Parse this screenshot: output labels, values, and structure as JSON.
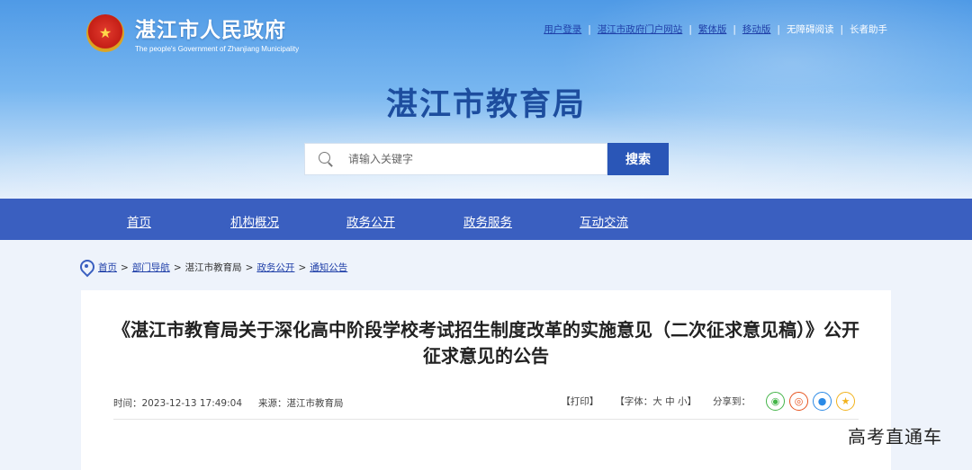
{
  "header": {
    "logo_cn": "湛江市人民政府",
    "logo_en": "The people's Government of Zhanjiang Municipality",
    "site_title": "湛江市教育局",
    "toplinks": [
      "用户登录",
      "湛江市政府门户网站",
      "繁体版",
      "移动版",
      "无障碍阅读",
      "长者助手"
    ]
  },
  "search": {
    "placeholder": "请输入关键字",
    "button": "搜索"
  },
  "nav": [
    "首页",
    "机构概况",
    "政务公开",
    "政务服务",
    "互动交流"
  ],
  "breadcrumb": [
    "首页",
    "部门导航",
    "湛江市教育局",
    "政务公开",
    "通知公告"
  ],
  "article": {
    "title": "《湛江市教育局关于深化高中阶段学校考试招生制度改革的实施意见（二次征求意见稿）》公开征求意见的公告",
    "time": "时间：2023-12-13 17:49:04",
    "source": "来源：湛江市教育局",
    "print": "【打印】",
    "font_size": "【字体：大 中 小】",
    "share_label": "分享到："
  },
  "watermark": "高考直通车",
  "colors": {
    "nav_bg": "#3a5fc0",
    "title_blue": "#1d4d9e",
    "search_btn": "#2a56b7"
  },
  "icons": [
    "national-emblem-icon",
    "search-icon",
    "location-pin-icon",
    "wechat-icon",
    "weibo-icon",
    "qq-icon",
    "qzone-icon"
  ]
}
